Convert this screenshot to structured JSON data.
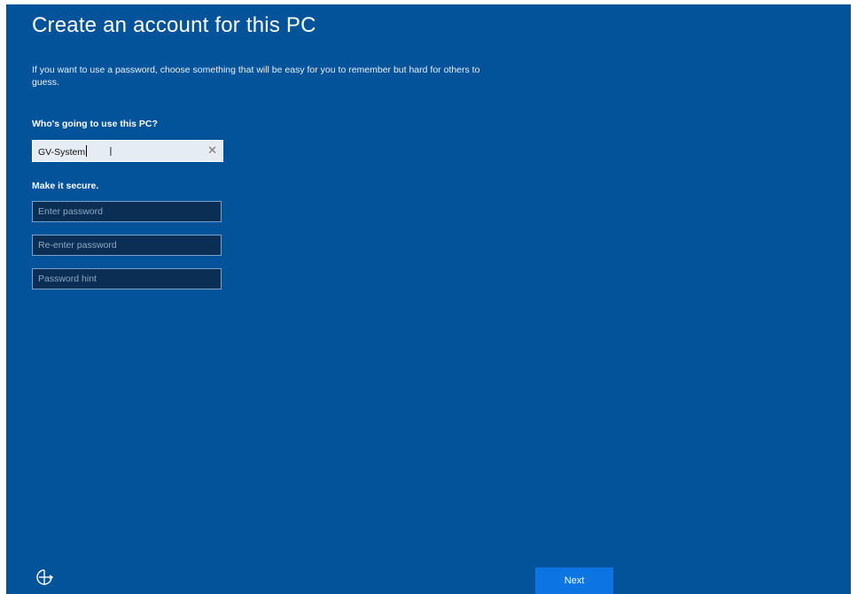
{
  "page": {
    "title": "Create an account for this PC",
    "description": "If you want to use a password, choose something that will be easy for you to remember but hard for others to guess."
  },
  "account": {
    "who_label": "Who's going to use this PC?",
    "username_value": "GV-System",
    "clear_glyph": "✕"
  },
  "security": {
    "label": "Make it secure.",
    "password_placeholder": "Enter password",
    "reenter_placeholder": "Re-enter password",
    "hint_placeholder": "Password hint"
  },
  "footer": {
    "next_label": "Next",
    "ease_of_access_icon": "ease-of-access-icon"
  },
  "colors": {
    "background": "#03539b",
    "input_dark": "#0a2e54",
    "input_border": "#7aa3cc",
    "button": "#0d74e3"
  }
}
